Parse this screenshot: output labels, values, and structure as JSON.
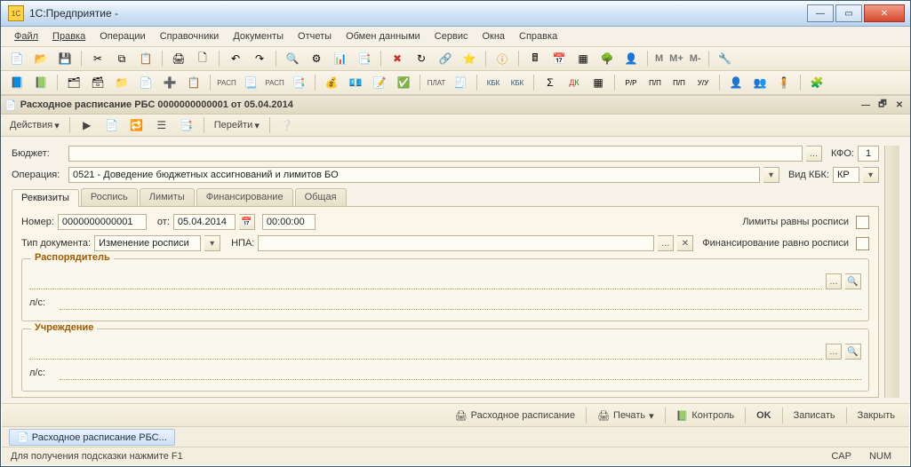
{
  "colors": {
    "accent": "#a25a00",
    "border": "#b9b18f"
  },
  "titlebar": {
    "title": "1С:Предприятие -"
  },
  "menubar": {
    "items": [
      "Файл",
      "Правка",
      "Операции",
      "Справочники",
      "Документы",
      "Отчеты",
      "Обмен данными",
      "Сервис",
      "Окна",
      "Справка"
    ]
  },
  "subwin": {
    "title": "Расходное расписание РБС 0000000000001 от 05.04.2014"
  },
  "actionbar": {
    "actions_label": "Действия",
    "goto_label": "Перейти"
  },
  "form": {
    "budget_label": "Бюджет:",
    "budget_value": "",
    "kfo_label": "КФО:",
    "kfo_value": "1",
    "operation_label": "Операция:",
    "operation_value": "0521 - Доведение бюджетных ассигнований и лимитов БО",
    "vidkbk_label": "Вид КБК:",
    "vidkbk_value": "КР",
    "tabs": [
      "Реквизиты",
      "Роспись",
      "Лимиты",
      "Финансирование",
      "Общая"
    ],
    "active_tab": 0,
    "number_label": "Номер:",
    "number_value": "0000000000001",
    "from_label": "от:",
    "date_value": "05.04.2014",
    "time_value": "00:00:00",
    "limits_eq_label": "Лимиты равны росписи",
    "doctype_label": "Тип документа:",
    "doctype_value": "Изменение росписи",
    "npa_label": "НПА:",
    "npa_value": "",
    "funding_eq_label": "Финансирование равно росписи",
    "group1_title": "Распорядитель",
    "group2_title": "Учреждение",
    "ls_label": "л/с:"
  },
  "bottombar": {
    "rash_label": "Расходное расписание",
    "print_label": "Печать",
    "control_label": "Контроль",
    "ok_label": "OK",
    "save_label": "Записать",
    "close_label": "Закрыть"
  },
  "taskbar": {
    "item": "Расходное расписание РБС..."
  },
  "statusbar": {
    "hint": "Для получения подсказки нажмите F1",
    "cap": "CAP",
    "num": "NUM"
  }
}
